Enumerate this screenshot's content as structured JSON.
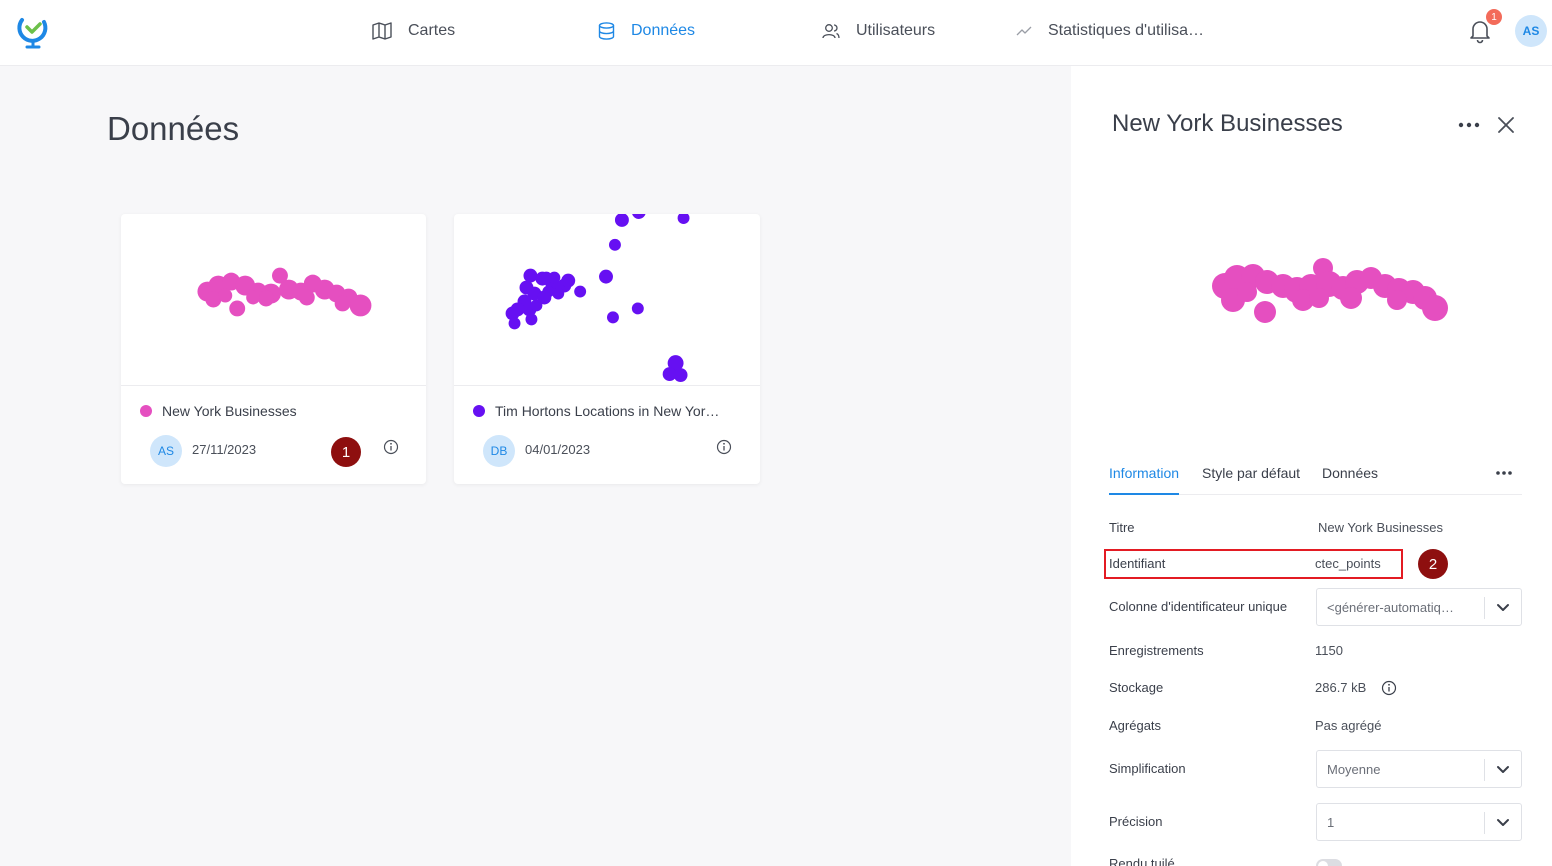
{
  "nav": {
    "items": [
      {
        "label": "Cartes",
        "icon": "map-icon",
        "active": false
      },
      {
        "label": "Données",
        "icon": "database-icon",
        "active": true
      },
      {
        "label": "Utilisateurs",
        "icon": "users-icon",
        "active": false
      },
      {
        "label": "Statistiques d'utilisa…",
        "icon": "trend-icon",
        "active": false
      }
    ],
    "notifications_count": "1",
    "user_initials": "AS"
  },
  "main": {
    "title": "Données",
    "cards": [
      {
        "name": "New York Businesses",
        "color": "#e54fc0",
        "owner_initials": "AS",
        "date": "27/11/2023"
      },
      {
        "name": "Tim Hortons Locations in New Yor…",
        "color": "#6610f2",
        "owner_initials": "DB",
        "date": "04/01/2023"
      }
    ]
  },
  "markers": {
    "one": "1",
    "two": "2"
  },
  "panel": {
    "title": "New York Businesses",
    "tabs": [
      "Information",
      "Style par défaut",
      "Données"
    ],
    "fields": {
      "titre_label": "Titre",
      "titre_value": "New York Businesses",
      "identifiant_label": "Identifiant",
      "identifiant_value": "ctec_points",
      "colonne_label": "Colonne d'identificateur unique",
      "colonne_value": "<générer-automatiq…",
      "enregistrements_label": "Enregistrements",
      "enregistrements_value": "1150",
      "stockage_label": "Stockage",
      "stockage_value": "286.7 kB",
      "agregats_label": "Agrégats",
      "agregats_value": "Pas agrégé",
      "simplification_label": "Simplification",
      "simplification_value": "Moyenne",
      "precision_label": "Précision",
      "precision_value": "1",
      "rendu_label": "Rendu tuilé"
    }
  },
  "colors": {
    "accent": "#1e88e5",
    "highlight": "#e31b23",
    "marker": "#8e0f0f"
  }
}
